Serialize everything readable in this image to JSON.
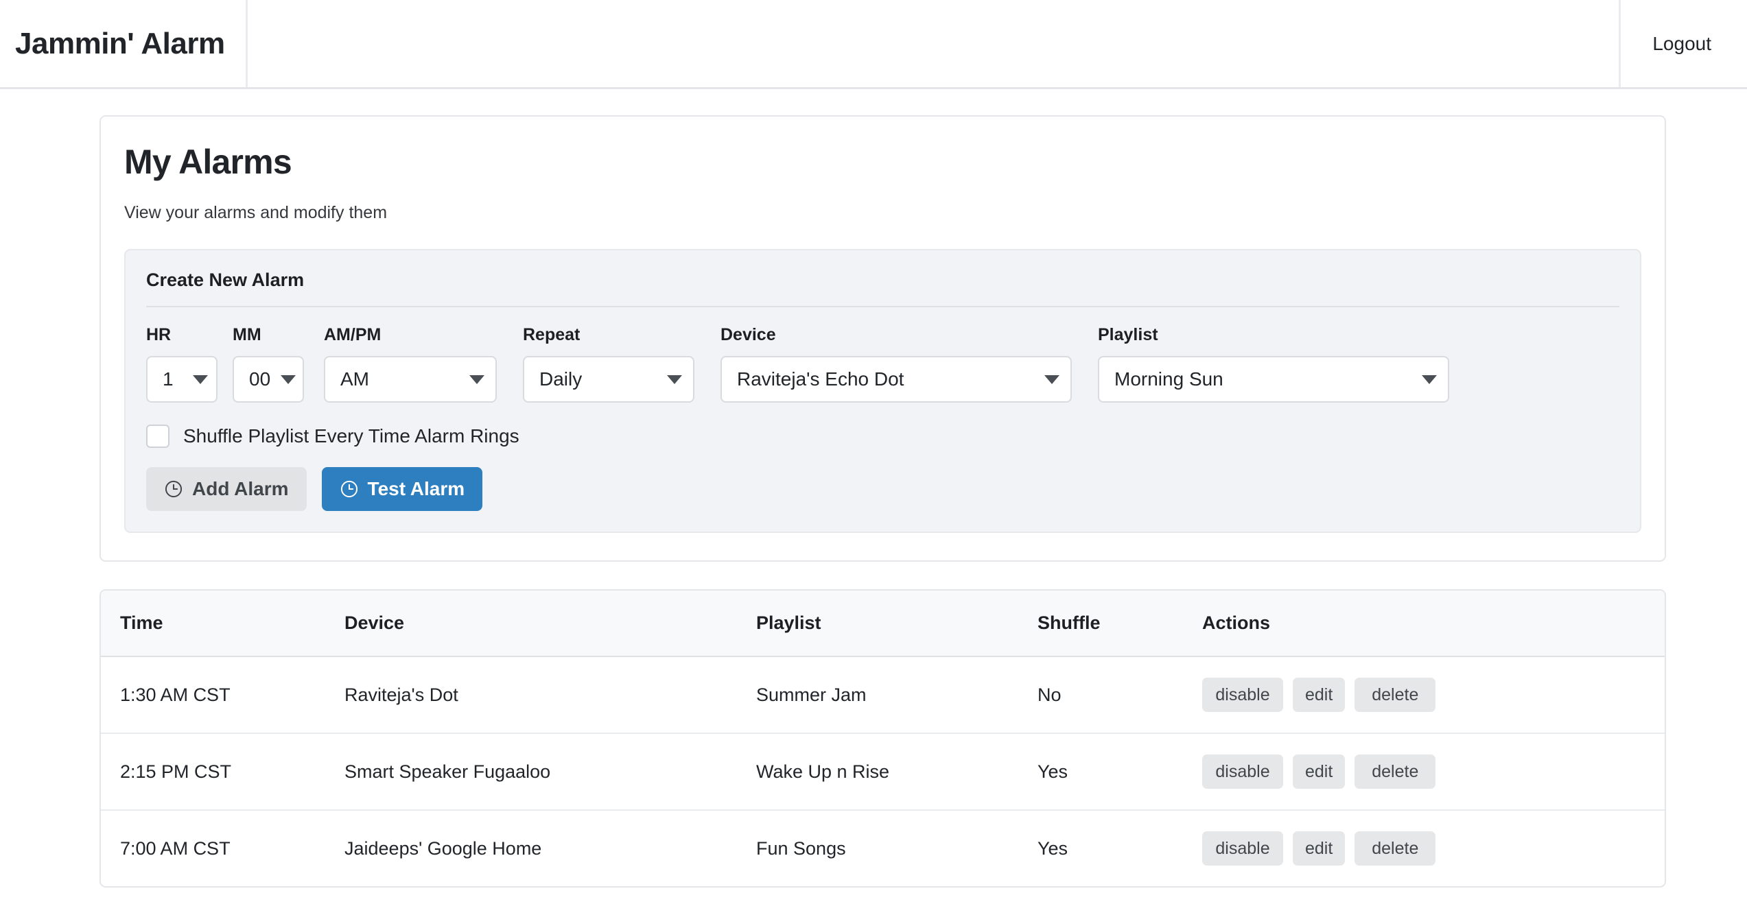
{
  "navbar": {
    "brand": "Jammin' Alarm",
    "logout_label": "Logout"
  },
  "main": {
    "title": "My Alarms",
    "subtitle": "View your alarms and modify them"
  },
  "create_panel": {
    "title": "Create New Alarm",
    "fields": {
      "hr": {
        "label": "HR",
        "value": "1"
      },
      "mm": {
        "label": "MM",
        "value": "00"
      },
      "ampm": {
        "label": "AM/PM",
        "value": "AM"
      },
      "repeat": {
        "label": "Repeat",
        "value": "Daily"
      },
      "device": {
        "label": "Device",
        "value": "Raviteja's Echo Dot"
      },
      "playlist": {
        "label": "Playlist",
        "value": "Morning Sun"
      }
    },
    "shuffle_checkbox": {
      "label": "Shuffle Playlist Every Time Alarm Rings",
      "checked": false
    },
    "buttons": {
      "add": {
        "label": "Add Alarm",
        "icon": "clock-icon",
        "style": "secondary"
      },
      "test": {
        "label": "Test Alarm",
        "icon": "clock-icon",
        "style": "primary"
      }
    }
  },
  "alarms_table": {
    "headers": [
      "Time",
      "Device",
      "Playlist",
      "Shuffle",
      "Actions"
    ],
    "rows": [
      {
        "time": "1:30 AM CST",
        "device": "Raviteja's Dot",
        "playlist": "Summer Jam",
        "shuffle": "No",
        "actions": [
          "disable",
          "edit",
          "delete"
        ]
      },
      {
        "time": "2:15 PM CST",
        "device": "Smart Speaker Fugaaloo",
        "playlist": "Wake Up n Rise",
        "shuffle": "Yes",
        "actions": [
          "disable",
          "edit",
          "delete"
        ]
      },
      {
        "time": "7:00 AM CST",
        "device": "Jaideeps' Google Home",
        "playlist": "Fun Songs",
        "shuffle": "Yes",
        "actions": [
          "disable",
          "edit",
          "delete"
        ]
      }
    ]
  },
  "colors": {
    "primary": "#2e7fbf",
    "secondary": "#e2e3e5",
    "panel_bg": "#f1f3f6",
    "table_head_bg": "#f8f9fa",
    "border": "#e4e6e9",
    "text": "#212529"
  }
}
